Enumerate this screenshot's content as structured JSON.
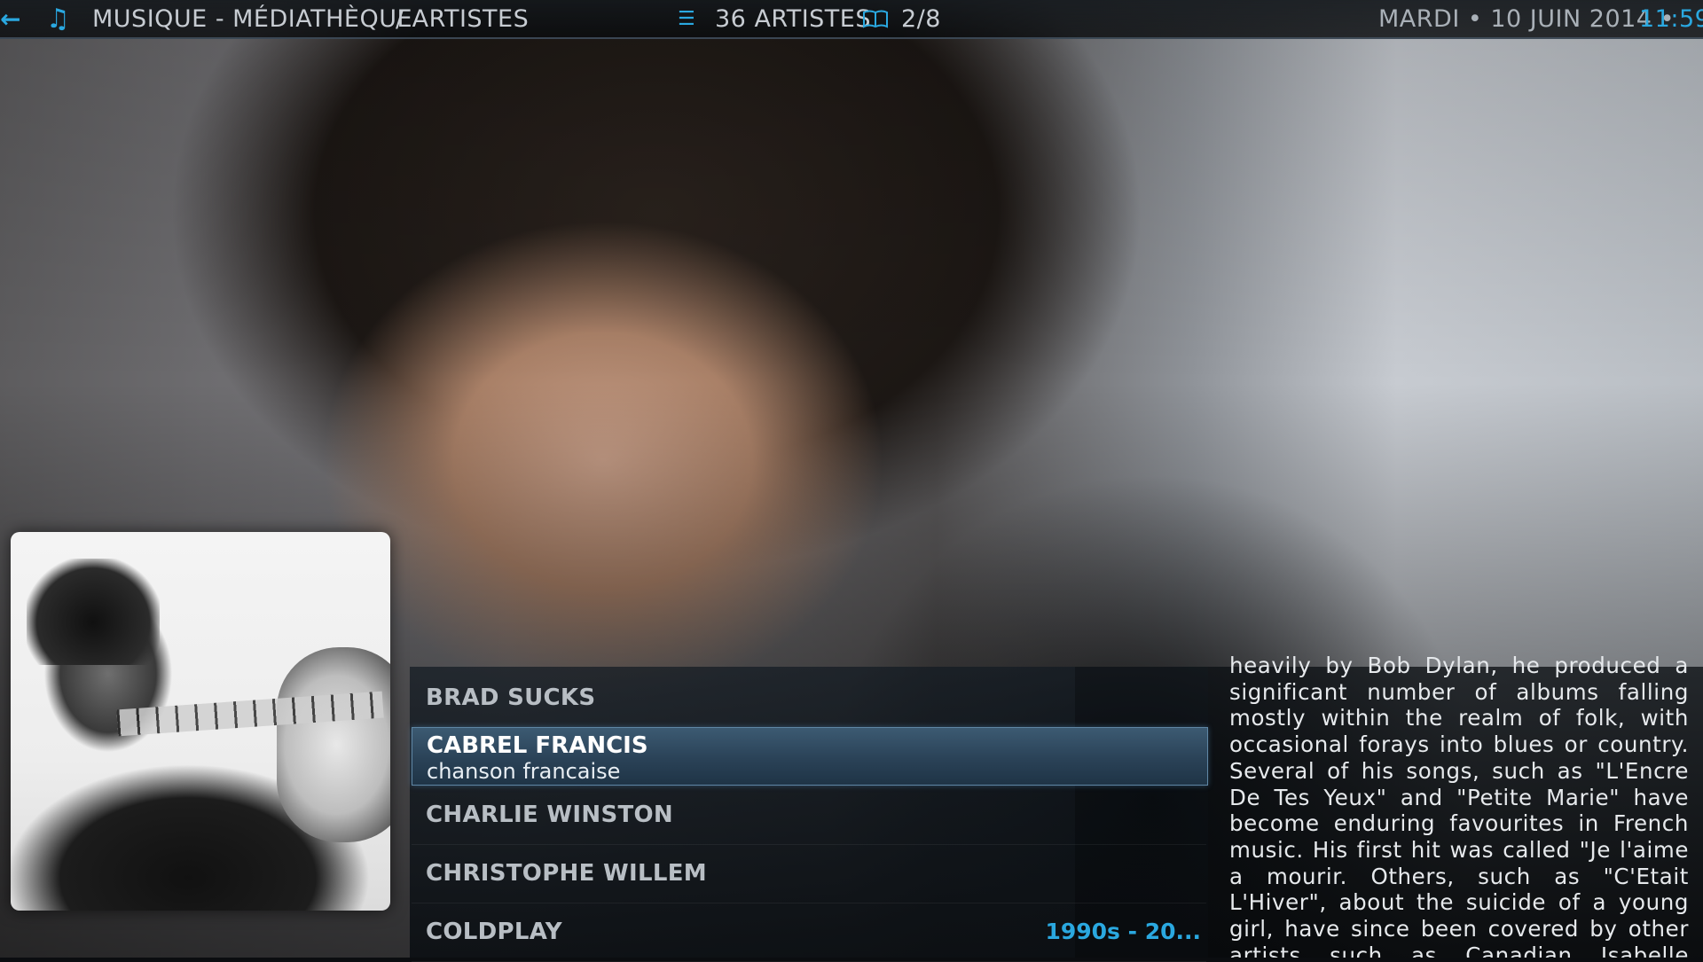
{
  "header": {
    "section": "MUSIQUE - MÉDIATHÈQUE",
    "breadcrumb": "/ ARTISTES",
    "count": "36 ARTISTES",
    "page": "2/8",
    "date": "MARDI • 10 JUIN 2014 •",
    "time": "11:59"
  },
  "icons": {
    "back": "back-arrow-icon",
    "music": "music-note-icon",
    "count": "list-icon",
    "page": "book-icon"
  },
  "colors": {
    "accent": "#2aa8e0",
    "selected_row": "#2a4257"
  },
  "artists": [
    {
      "name": "BRAD SUCKS",
      "meta": ""
    },
    {
      "name": "CABREL FRANCIS",
      "genre": "chanson francaise",
      "selected": true
    },
    {
      "name": "CHARLIE WINSTON",
      "meta": ""
    },
    {
      "name": "CHRISTOPHE WILLEM",
      "meta": ""
    },
    {
      "name": "COLDPLAY",
      "meta": "1990s - 20..."
    }
  ],
  "plot": "heavily by Bob Dylan, he produced a significant number of albums falling mostly within the realm of folk, with occasional forays into blues or country. Several of his songs, such as \"L'Encre De Tes Yeux\" and \"Petite Marie\" have become enduring favourites in French music. His first hit was called \"Je l'aime a mourir. Others, such as \"C'Etait L'Hiver\",  about the suicide of a young girl, have since been covered by other artists such as Canadian Isabelle Boulay."
}
